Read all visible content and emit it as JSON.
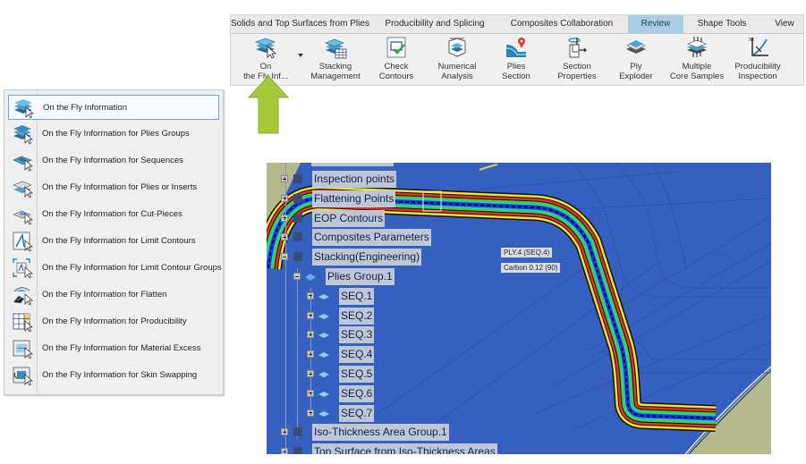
{
  "ribbon": {
    "tabs": [
      {
        "label": "Solids and Top Surfaces from Plies",
        "active": false
      },
      {
        "label": "Producibility and Splicing",
        "active": false
      },
      {
        "label": "Composites Collaboration",
        "active": false
      },
      {
        "label": "Review",
        "active": true
      },
      {
        "label": "Shape Tools",
        "active": false
      },
      {
        "label": "View",
        "active": false
      }
    ],
    "tools": [
      {
        "line1": "On",
        "line2": "the Fly Inf...",
        "icon": "on-the-fly-info-icon"
      },
      {
        "line1": "Stacking",
        "line2": "Management",
        "icon": "stacking-management-icon"
      },
      {
        "line1": "Check",
        "line2": "Contours",
        "icon": "check-contours-icon"
      },
      {
        "line1": "Numerical",
        "line2": "Analysis",
        "icon": "numerical-analysis-icon"
      },
      {
        "line1": "Plies",
        "line2": "Section",
        "icon": "plies-section-icon"
      },
      {
        "line1": "Section",
        "line2": "Properties",
        "icon": "section-properties-icon"
      },
      {
        "line1": "Ply",
        "line2": "Exploder",
        "icon": "ply-exploder-icon"
      },
      {
        "line1": "Multiple",
        "line2": "Core Samples",
        "icon": "multiple-core-samples-icon"
      },
      {
        "line1": "Producibility",
        "line2": "Inspection",
        "icon": "producibility-inspection-icon"
      }
    ]
  },
  "menu": {
    "items": [
      {
        "label": "On the Fly Information",
        "highlighted": true
      },
      {
        "label": "On the Fly Information for Plies Groups"
      },
      {
        "label": "On the Fly Information for Sequences"
      },
      {
        "label": "On the Fly Information for Plies or Inserts"
      },
      {
        "label": "On the Fly Information for Cut-Pieces"
      },
      {
        "label": "On the Fly Information for Limit Contours"
      },
      {
        "label": "On the Fly Information for Limit Contour Groups"
      },
      {
        "label": "On the Fly Information for Flatten"
      },
      {
        "label": "On the Fly Information for Producibility"
      },
      {
        "label": "On the Fly Information for Material Excess"
      },
      {
        "label": "On the Fly Information for Skin Swapping"
      }
    ]
  },
  "tree": {
    "items": [
      {
        "label": "Inspection points",
        "level": 0,
        "expander": "plus"
      },
      {
        "label": "Flattening Points",
        "level": 0,
        "expander": "plus"
      },
      {
        "label": "EOP Contours",
        "level": 0,
        "expander": "plus"
      },
      {
        "label": "Composites Parameters",
        "level": 0,
        "expander": "plus"
      },
      {
        "label": "Stacking(Engineering)",
        "level": 0,
        "expander": "minus"
      },
      {
        "label": "Plies Group.1",
        "level": 1,
        "expander": "minus"
      },
      {
        "label": "SEQ.1",
        "level": 2,
        "expander": "plus"
      },
      {
        "label": "SEQ.2",
        "level": 2,
        "expander": "plus"
      },
      {
        "label": "SEQ.3",
        "level": 2,
        "expander": "plus"
      },
      {
        "label": "SEQ.4",
        "level": 2,
        "expander": "plus"
      },
      {
        "label": "SEQ.5",
        "level": 2,
        "expander": "plus"
      },
      {
        "label": "SEQ.6",
        "level": 2,
        "expander": "plus"
      },
      {
        "label": "SEQ.7",
        "level": 2,
        "expander": "plus"
      },
      {
        "label": "Iso-Thickness Area Group.1",
        "level": 0,
        "expander": "plus"
      },
      {
        "label": "Top Surface from Iso-Thickness Areas",
        "level": 0,
        "expander": "plus"
      }
    ]
  },
  "annotation": {
    "ply_label": "PLY.4  (SEQ.4)",
    "material_label": "Carbon 0.12  (90)"
  },
  "colors": {
    "viewer_bg": "#3560c0",
    "ply_yellow": "#f2e13a",
    "ply_red": "#e0322a",
    "ply_green": "#3ed33e",
    "ply_blue": "#1d3fd8",
    "ply_cyan": "#28c8d8",
    "review_tab": "#a9cfe8",
    "arrow_green": "#a6c93a"
  }
}
